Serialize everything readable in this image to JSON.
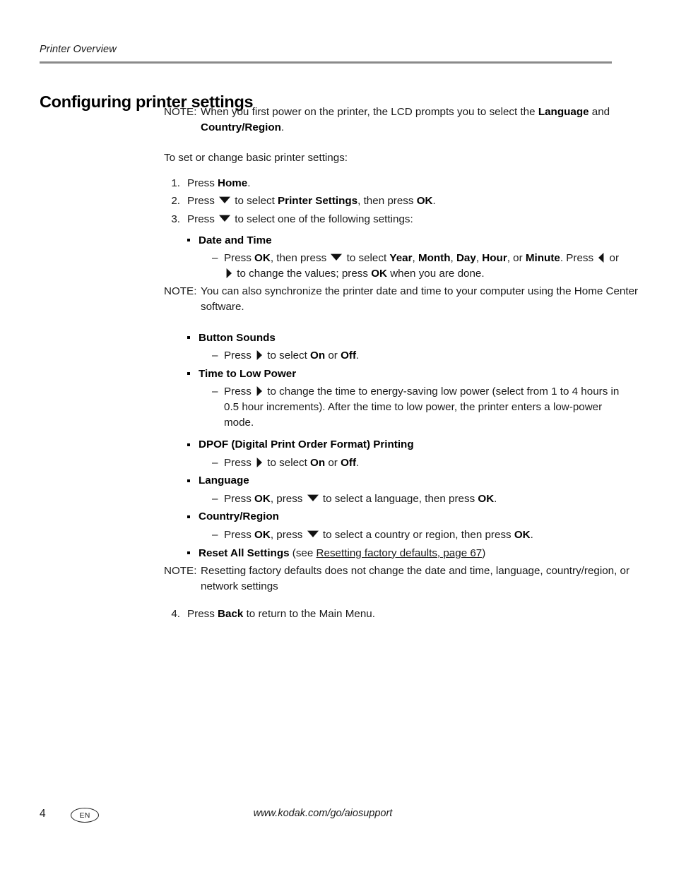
{
  "header": {
    "running_head": "Printer Overview"
  },
  "title": "Configuring printer settings",
  "colors": {
    "link": "#2222DD",
    "rule": "#8A8A8A",
    "text": "#1A1A1A"
  },
  "notes": {
    "label": "NOTE:",
    "first": {
      "text_a": "When you first power on the printer, the LCD prompts you to select the ",
      "bold_a": "Language",
      "text_b": " and ",
      "bold_b": "Country/Region",
      "text_c": "."
    },
    "sync": {
      "text": "You can also synchronize the printer date and time to your computer using the Home Center software."
    },
    "reset": {
      "text": "Resetting factory defaults does not change the date and time, language, country/region, or network settings"
    }
  },
  "intro": "To set or change basic printer settings:",
  "steps": [
    {
      "num": "1.",
      "pre": "Press ",
      "bold": "Home",
      "post": "."
    },
    {
      "num": "2.",
      "pre": "Press ",
      "icon": "arrow-down-icon",
      "mid": " to select ",
      "bold": "Printer Settings",
      "mid2": ", then press ",
      "bold2": "OK",
      "post": "."
    },
    {
      "num": "3.",
      "pre": "Press ",
      "icon": "arrow-down-icon",
      "mid": " to select one of the following settings:"
    },
    {
      "num": "4.",
      "pre": "Press ",
      "bold": "Back",
      "post": " to return to the Main Menu."
    }
  ],
  "settings": [
    {
      "name": "Date and Time",
      "detail": {
        "dash": "–",
        "t1": "Press ",
        "b1": "OK",
        "t2": ", then press ",
        "icon1": "arrow-down-icon",
        "t3": " to select ",
        "b2": "Year",
        "t4": ", ",
        "b3": "Month",
        "t5": ", ",
        "b4": "Day",
        "t6": ", ",
        "b5": "Hour",
        "t7": ", or ",
        "b6": "Minute",
        "t8": ". Press ",
        "icon2": "arrow-left-icon",
        "t9": " or ",
        "icon3": "arrow-right-icon",
        "t10": " to change the values; press ",
        "b7": "OK",
        "t11": " when you are done."
      }
    },
    {
      "name": "Button Sounds",
      "detail": {
        "dash": "–",
        "t1": "Press ",
        "icon1": "arrow-right-icon",
        "t2": " to select ",
        "b1": "On",
        "t3": " or ",
        "b2": "Off",
        "t4": "."
      }
    },
    {
      "name": "Time to Low Power",
      "detail": {
        "dash": "–",
        "t1": "Press ",
        "icon1": "arrow-right-icon",
        "t2": " to change the time to energy-saving low power (select from 1 to 4 hours in 0.5 hour increments). After the time to low power, the printer enters a low-power mode."
      }
    },
    {
      "name": "DPOF (Digital Print Order Format) Printing",
      "detail": {
        "dash": "–",
        "t1": "Press ",
        "icon1": "arrow-right-icon",
        "t2": " to select ",
        "b1": "On",
        "t3": " or ",
        "b2": "Off",
        "t4": "."
      }
    },
    {
      "name": "Language",
      "detail": {
        "dash": "–",
        "t1": "Press ",
        "b1": "OK",
        "t2": ", press ",
        "icon1": "arrow-down-icon",
        "t3": " to select a language, then press ",
        "b2": "OK",
        "t4": "."
      }
    },
    {
      "name": "Country/Region",
      "detail": {
        "dash": "–",
        "t1": "Press ",
        "b1": "OK",
        "t2": ", press ",
        "icon1": "arrow-down-icon",
        "t3": " to select a country or region, then press ",
        "b2": "OK",
        "t4": "."
      }
    }
  ],
  "reset_setting": {
    "name": "Reset All Settings",
    "paren_open": " (see ",
    "link_text": "Resetting factory defaults, page 67",
    "paren_close": ")"
  },
  "footer": {
    "page_number": "4",
    "language_badge": "EN",
    "url": "www.kodak.com/go/aiosupport"
  }
}
